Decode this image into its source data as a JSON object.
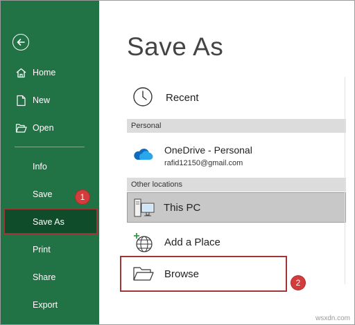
{
  "sidebar": {
    "back_icon": "back-arrow-icon",
    "items": [
      {
        "label": "Home",
        "icon": "home-icon"
      },
      {
        "label": "New",
        "icon": "new-document-icon"
      },
      {
        "label": "Open",
        "icon": "folder-open-icon"
      },
      {
        "label": "Info"
      },
      {
        "label": "Save"
      },
      {
        "label": "Save As",
        "active": true
      },
      {
        "label": "Print"
      },
      {
        "label": "Share"
      },
      {
        "label": "Export"
      }
    ],
    "colors": {
      "background": "#217346",
      "active": "#0f4d2a"
    }
  },
  "main": {
    "title": "Save As",
    "recent": {
      "label": "Recent",
      "icon": "clock-icon"
    },
    "personal_header": "Personal",
    "onedrive": {
      "label": "OneDrive - Personal",
      "email": "rafid12150@gmail.com",
      "icon": "cloud-icon"
    },
    "other_header": "Other locations",
    "this_pc": {
      "label": "This PC",
      "icon": "computer-icon"
    },
    "add_place": {
      "label": "Add a Place",
      "icon": "globe-add-icon"
    },
    "browse": {
      "label": "Browse",
      "icon": "folder-icon"
    }
  },
  "annotations": {
    "badge1": "1",
    "badge2": "2",
    "highlight_color": "#a23434"
  },
  "watermark": "wsxdn.com"
}
